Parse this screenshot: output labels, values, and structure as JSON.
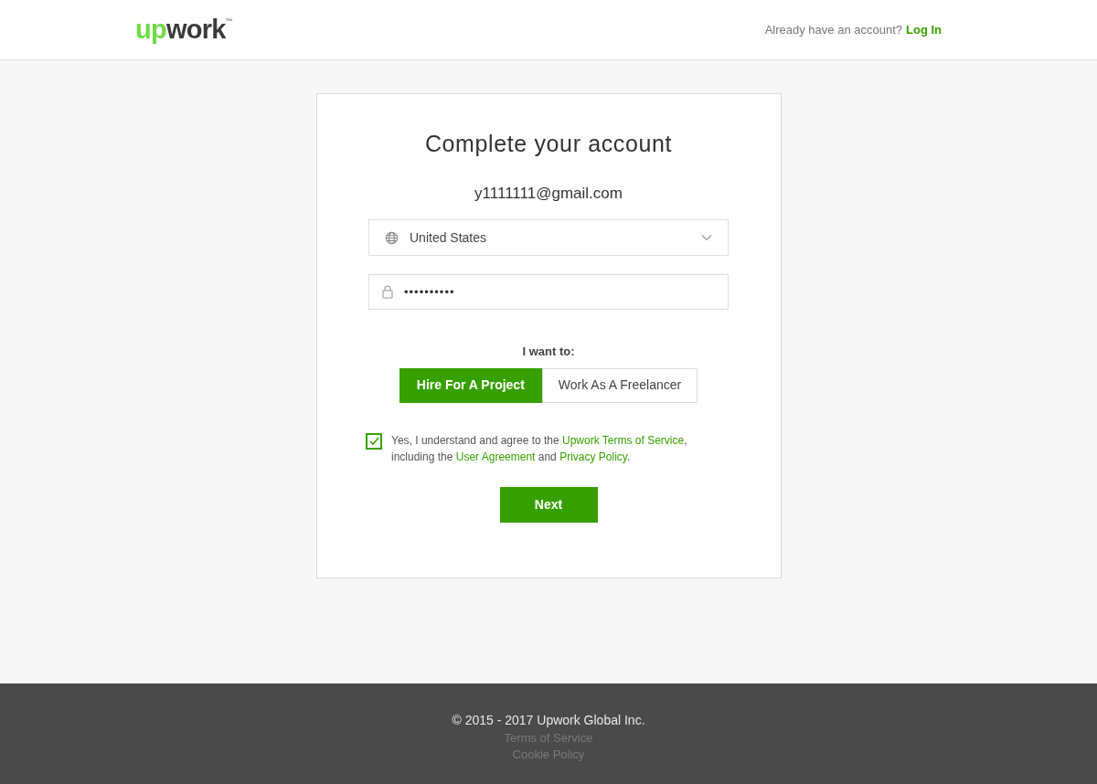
{
  "header": {
    "logo": {
      "accent": "up",
      "rest": "work",
      "mark": "™"
    },
    "account_prompt": "Already have an account?",
    "login_link": "Log In"
  },
  "card": {
    "title": "Complete your account",
    "email": "y1111111@gmail.com",
    "country_select": {
      "value": "United States"
    },
    "password_field": {
      "value": "••••••••••"
    },
    "role_label": "I want to:",
    "roles": [
      {
        "label": "Hire For A Project",
        "selected": true
      },
      {
        "label": "Work As A Freelancer",
        "selected": false
      }
    ],
    "agreement": {
      "checked": true,
      "parts": [
        {
          "kind": "text",
          "text": "Yes, I understand and agree to the "
        },
        {
          "kind": "link",
          "text": "Upwork Terms of Service"
        },
        {
          "kind": "text",
          "text": ", including the "
        },
        {
          "kind": "link",
          "text": "User Agreement"
        },
        {
          "kind": "text",
          "text": " and "
        },
        {
          "kind": "link",
          "text": "Privacy Policy"
        },
        {
          "kind": "text",
          "text": "."
        }
      ]
    },
    "next_button": "Next"
  },
  "footer": {
    "copyright": "© 2015 - 2017 Upwork Global Inc.",
    "links": [
      "Terms of Service",
      "Cookie Policy"
    ]
  }
}
